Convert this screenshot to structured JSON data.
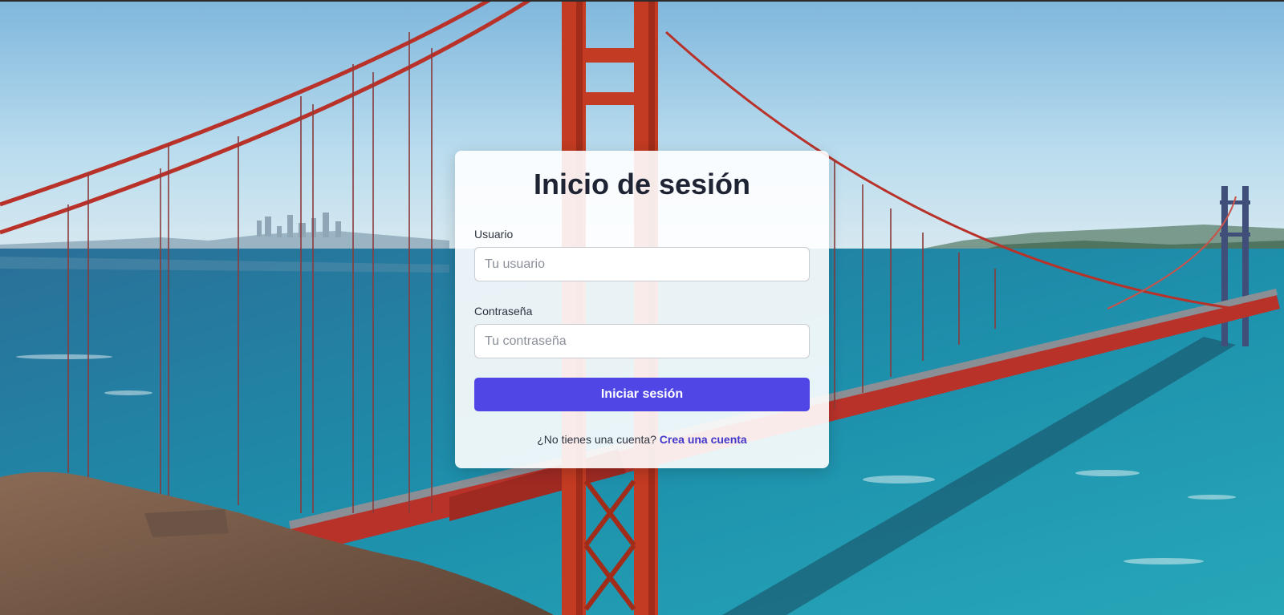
{
  "login": {
    "title": "Inicio de sesión",
    "username_label": "Usuario",
    "username_placeholder": "Tu usuario",
    "password_label": "Contraseña",
    "password_placeholder": "Tu contraseña",
    "submit_label": "Iniciar sesión",
    "signup_prompt": "¿No tienes una cuenta?",
    "signup_link": "Crea una cuenta"
  },
  "colors": {
    "accent": "#4f46e5",
    "link": "#4338ca",
    "bridge": "#c23b22",
    "sea": "#1f8aa8",
    "sky": "#a9d3ea"
  }
}
